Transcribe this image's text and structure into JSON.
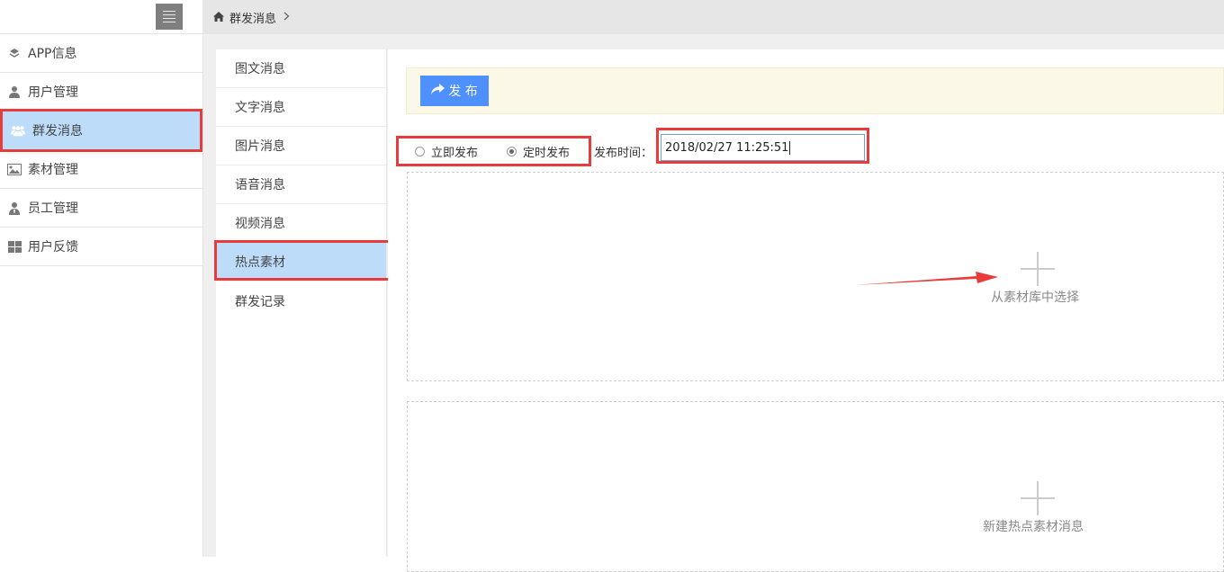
{
  "sidebar": {
    "items": [
      {
        "label": "APP信息",
        "icon": "layers-icon"
      },
      {
        "label": "用户管理",
        "icon": "user-icon"
      },
      {
        "label": "群发消息",
        "icon": "users-group-icon",
        "active": true
      },
      {
        "label": "素材管理",
        "icon": "image-icon"
      },
      {
        "label": "员工管理",
        "icon": "staff-icon"
      },
      {
        "label": "用户反馈",
        "icon": "grid-icon"
      }
    ]
  },
  "breadcrumb": {
    "current": "群发消息"
  },
  "subnav": {
    "items": [
      {
        "label": "图文消息"
      },
      {
        "label": "文字消息"
      },
      {
        "label": "图片消息"
      },
      {
        "label": "语音消息"
      },
      {
        "label": "视频消息"
      },
      {
        "label": "热点素材",
        "active": true
      },
      {
        "label": "群发记录"
      }
    ]
  },
  "toolbar": {
    "publish_label": "发 布"
  },
  "publish_mode": {
    "immediate_label": "立即发布",
    "scheduled_label": "定时发布",
    "selected": "定时发布"
  },
  "publish_time": {
    "label": "发布时间：",
    "value": "2018/02/27 11:25:51"
  },
  "dropzones": {
    "select_label": "从素材库中选择",
    "new_label": "新建热点素材消息"
  },
  "colors": {
    "accent": "#4d90fe",
    "active_bg": "#bcdcf9",
    "highlight": "#e83c3c",
    "toolbar_bg": "#fcf8e8"
  }
}
